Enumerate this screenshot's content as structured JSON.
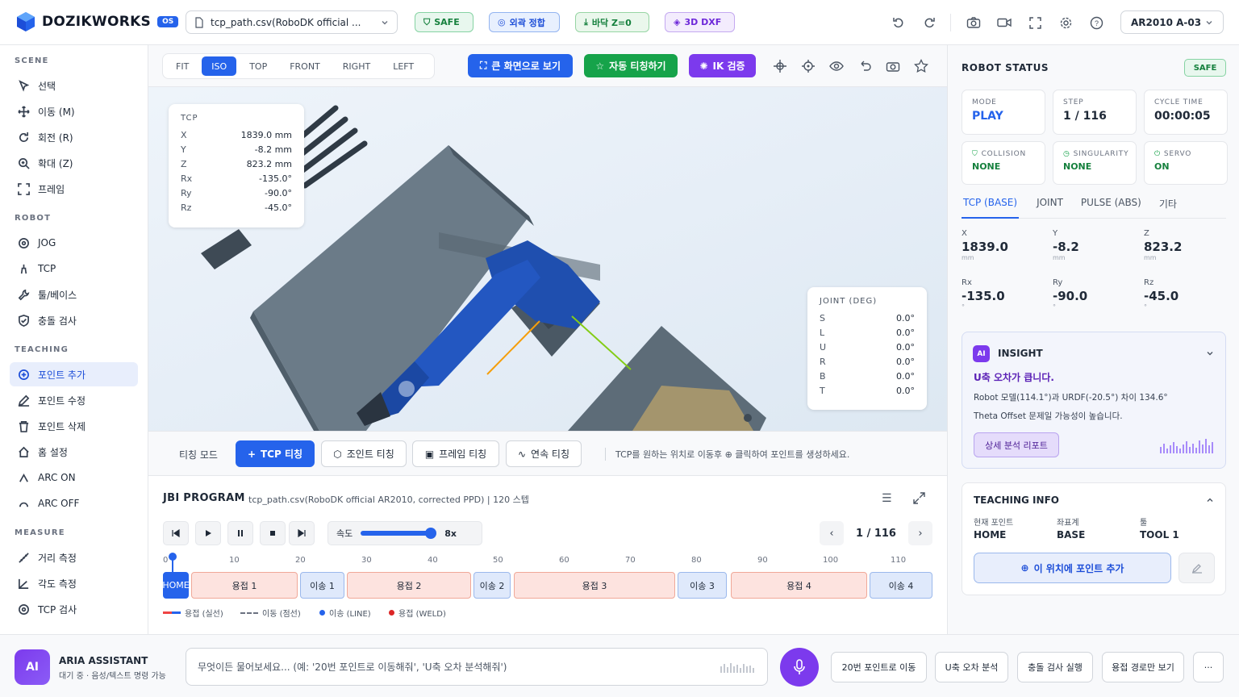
{
  "app": {
    "brand": "DOZIKWORKS",
    "os_badge": "OS"
  },
  "top": {
    "file": "tcp_path.csv(RoboDK official ...",
    "chips": {
      "safe": "SAFE",
      "calibration": "외곽 정합",
      "floor": "바닥 Z=0",
      "dxf": "3D DXF"
    },
    "robot": "AR2010 A-03"
  },
  "sidebar": {
    "scene_title": "SCENE",
    "scene": [
      "선택",
      "이동 (M)",
      "회전 (R)",
      "확대 (Z)",
      "프레임"
    ],
    "robot_title": "ROBOT",
    "robot": [
      "JOG",
      "TCP",
      "툴/베이스",
      "충돌 검사"
    ],
    "teaching_title": "TEACHING",
    "teaching": [
      "포인트 추가",
      "포인트 수정",
      "포인트 삭제",
      "홈 설정",
      "ARC ON",
      "ARC OFF"
    ],
    "measure_title": "MEASURE",
    "measure": [
      "거리 측정",
      "각도 측정",
      "TCP 검사"
    ]
  },
  "viewbar": {
    "views": [
      "FIT",
      "ISO",
      "TOP",
      "FRONT",
      "RIGHT",
      "LEFT"
    ],
    "active_view": "ISO",
    "fullscreen": "큰 화면으로 보기",
    "auto_teach": "자동 티칭하기",
    "ik": "IK 검증"
  },
  "tcp": {
    "title": "TCP",
    "rows": [
      {
        "k": "X",
        "v": "1839.0 mm"
      },
      {
        "k": "Y",
        "v": "-8.2 mm"
      },
      {
        "k": "Z",
        "v": "823.2 mm"
      },
      {
        "k": "Rx",
        "v": "-135.0°"
      },
      {
        "k": "Ry",
        "v": "-90.0°"
      },
      {
        "k": "Rz",
        "v": "-45.0°"
      }
    ]
  },
  "joint": {
    "title": "JOINT (DEG)",
    "rows": [
      {
        "k": "S",
        "v": "0.0°"
      },
      {
        "k": "L",
        "v": "0.0°"
      },
      {
        "k": "U",
        "v": "0.0°"
      },
      {
        "k": "R",
        "v": "0.0°"
      },
      {
        "k": "B",
        "v": "0.0°"
      },
      {
        "k": "T",
        "v": "0.0°"
      }
    ]
  },
  "teach": {
    "label": "티칭 모드",
    "buttons": [
      "TCP 티칭",
      "조인트 티칭",
      "프레임 티칭",
      "연속 티칭"
    ],
    "hint": "TCP를 원하는 위치로 이동후 ⊕ 클릭하여 포인트를 생성하세요."
  },
  "jbi": {
    "title": "JBI PROGRAM",
    "subtitle": "tcp_path.csv(RoboDK official AR2010, corrected PPD) | 120 스텝",
    "speed_label": "속도",
    "speed_value": "8x",
    "speed_fraction": 0.85,
    "step": "1 / 116",
    "ticks": [
      "0",
      "10",
      "20",
      "30",
      "40",
      "50",
      "60",
      "70",
      "80",
      "90",
      "100",
      "110"
    ],
    "segments": [
      {
        "label": "HOME",
        "type": "home"
      },
      {
        "label": "용접 1",
        "type": "weld"
      },
      {
        "label": "이송 1",
        "type": "move"
      },
      {
        "label": "용접 2",
        "type": "weld"
      },
      {
        "label": "이송 2",
        "type": "move"
      },
      {
        "label": "용접 3",
        "type": "weld"
      },
      {
        "label": "이송 3",
        "type": "move"
      },
      {
        "label": "용접 4",
        "type": "weld"
      },
      {
        "label": "이송 4",
        "type": "move"
      }
    ],
    "legend": [
      "용접 (실선)",
      "이동 (점선)",
      "이송 (LINE)",
      "용접 (WELD)"
    ]
  },
  "status": {
    "title": "ROBOT STATUS",
    "badge": "SAFE",
    "mode_label": "MODE",
    "mode": "PLAY",
    "step_label": "STEP",
    "step": "1 / 116",
    "cycle_label": "CYCLE TIME",
    "cycle": "00:00:05",
    "collision_label": "COLLISION",
    "collision": "NONE",
    "singularity_label": "SINGULARITY",
    "singularity": "NONE",
    "servo_label": "SERVO",
    "servo": "ON",
    "tabs": [
      "TCP (BASE)",
      "JOINT",
      "PULSE (ABS)",
      "기타"
    ],
    "coords": [
      {
        "k": "X",
        "v": "1839.0",
        "u": "mm"
      },
      {
        "k": "Y",
        "v": "-8.2",
        "u": "mm"
      },
      {
        "k": "Z",
        "v": "823.2",
        "u": "mm"
      },
      {
        "k": "Rx",
        "v": "-135.0",
        "u": "°"
      },
      {
        "k": "Ry",
        "v": "-90.0",
        "u": "°"
      },
      {
        "k": "Rz",
        "v": "-45.0",
        "u": "°"
      }
    ]
  },
  "insight": {
    "badge": "AI",
    "title": "INSIGHT",
    "headline": "U축 오차가 큽니다.",
    "line1": "Robot 모델(114.1°)과 URDF(-20.5°) 차이 134.6°",
    "line2": "Theta Offset 문제일 가능성이 높습니다.",
    "button": "상세 분석 리포트"
  },
  "teaching_info": {
    "title": "TEACHING INFO",
    "cur_label": "현재 포인트",
    "cur": "HOME",
    "coord_label": "좌표계",
    "coord": "BASE",
    "tool_label": "툴",
    "tool": "TOOL 1",
    "add_button": "이 위치에 포인트 추가"
  },
  "assistant": {
    "avatar": "AI",
    "name": "ARIA ASSISTANT",
    "status": "대기 중 · 음성/텍스트 명령 가능",
    "placeholder": "무엇이든 물어보세요... (예: '20번 포인트로 이동해줘', 'U축 오차 분석해줘')",
    "quick": [
      "20번 포인트로 이동",
      "U축 오차 분석",
      "충돌 검사 실행",
      "용접 경로만 보기"
    ],
    "more": "···"
  }
}
